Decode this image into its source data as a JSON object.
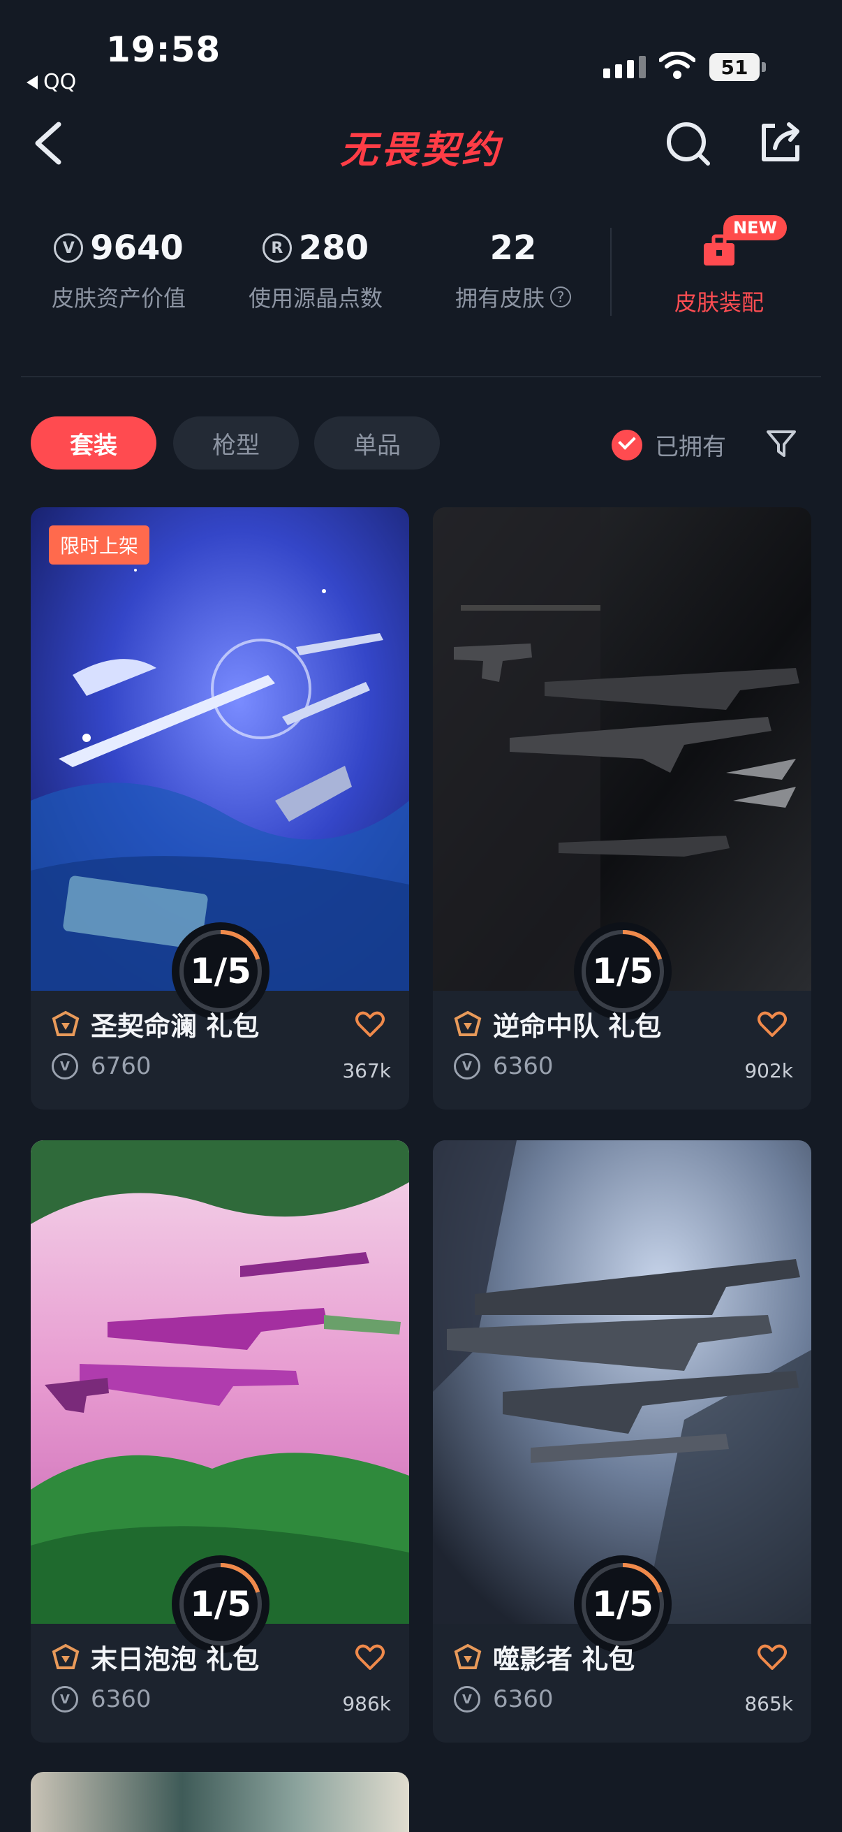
{
  "status_bar": {
    "time": "19:58",
    "back_app": "QQ",
    "battery": "51"
  },
  "header": {
    "title": "无畏契约"
  },
  "stats": [
    {
      "value": "9640",
      "label": "皮肤资产价值",
      "icon": "vp-coin-icon"
    },
    {
      "value": "280",
      "label": "使用源晶点数",
      "icon": "radianite-icon"
    },
    {
      "value": "22",
      "label": "拥有皮肤",
      "icon": "help-icon"
    }
  ],
  "equip": {
    "label": "皮肤装配",
    "badge": "NEW"
  },
  "filters": {
    "tabs": [
      {
        "label": "套装",
        "active": true
      },
      {
        "label": "枪型",
        "active": false
      },
      {
        "label": "单品",
        "active": false
      }
    ],
    "owned_label": "已拥有"
  },
  "cards": [
    {
      "tag": "限时上架",
      "progress": "1/5",
      "progress_fraction": 0.2,
      "name": "圣契命澜 礼包",
      "price": "6760",
      "likes": "367k"
    },
    {
      "tag": "",
      "progress": "1/5",
      "progress_fraction": 0.2,
      "name": "逆命中队 礼包",
      "price": "6360",
      "likes": "902k"
    },
    {
      "tag": "",
      "progress": "1/5",
      "progress_fraction": 0.2,
      "name": "末日泡泡 礼包",
      "price": "6360",
      "likes": "986k"
    },
    {
      "tag": "",
      "progress": "1/5",
      "progress_fraction": 0.2,
      "name": "噬影者 礼包",
      "price": "6360",
      "likes": "865k"
    }
  ],
  "colors": {
    "accent": "#ff4b50",
    "background": "#141a24",
    "progress": "#f08a4b"
  }
}
